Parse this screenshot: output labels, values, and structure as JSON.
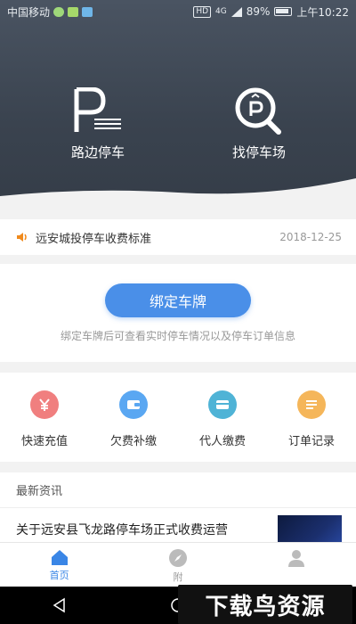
{
  "status_bar": {
    "carrier": "中国移动",
    "network": "HD",
    "signal": "4G",
    "battery": "89%",
    "time": "上午10:22"
  },
  "hero": {
    "items": [
      {
        "label": "路边停车",
        "icon": "parking-p-icon"
      },
      {
        "label": "找停车场",
        "icon": "search-parking-icon"
      }
    ]
  },
  "notice": {
    "text": "远安城投停车收费标准",
    "date": "2018-12-25"
  },
  "bind_plate": {
    "button_label": "绑定车牌",
    "tip": "绑定车牌后可查看实时停车情况以及停车订单信息"
  },
  "actions": [
    {
      "label": "快速充值",
      "icon": "yuan-icon",
      "color": "#f07f7f"
    },
    {
      "label": "欠费补缴",
      "icon": "wallet-icon",
      "color": "#5aa7f2"
    },
    {
      "label": "代人缴费",
      "icon": "card-icon",
      "color": "#4fb3d6"
    },
    {
      "label": "订单记录",
      "icon": "list-icon",
      "color": "#f5b65a"
    }
  ],
  "news": {
    "heading": "最新资讯",
    "items": [
      {
        "title": "关于远安县飞龙路停车场正式收费运营"
      }
    ]
  },
  "tabbar": {
    "tabs": [
      {
        "label": "首页",
        "active": true
      },
      {
        "label": "附",
        "active": false
      },
      {
        "label": "",
        "active": false
      }
    ]
  },
  "watermark": "下载鸟资源",
  "colors": {
    "accent": "#4a8fe8",
    "tab_active": "#3a86e6",
    "hero_bg": "#3e4754"
  }
}
